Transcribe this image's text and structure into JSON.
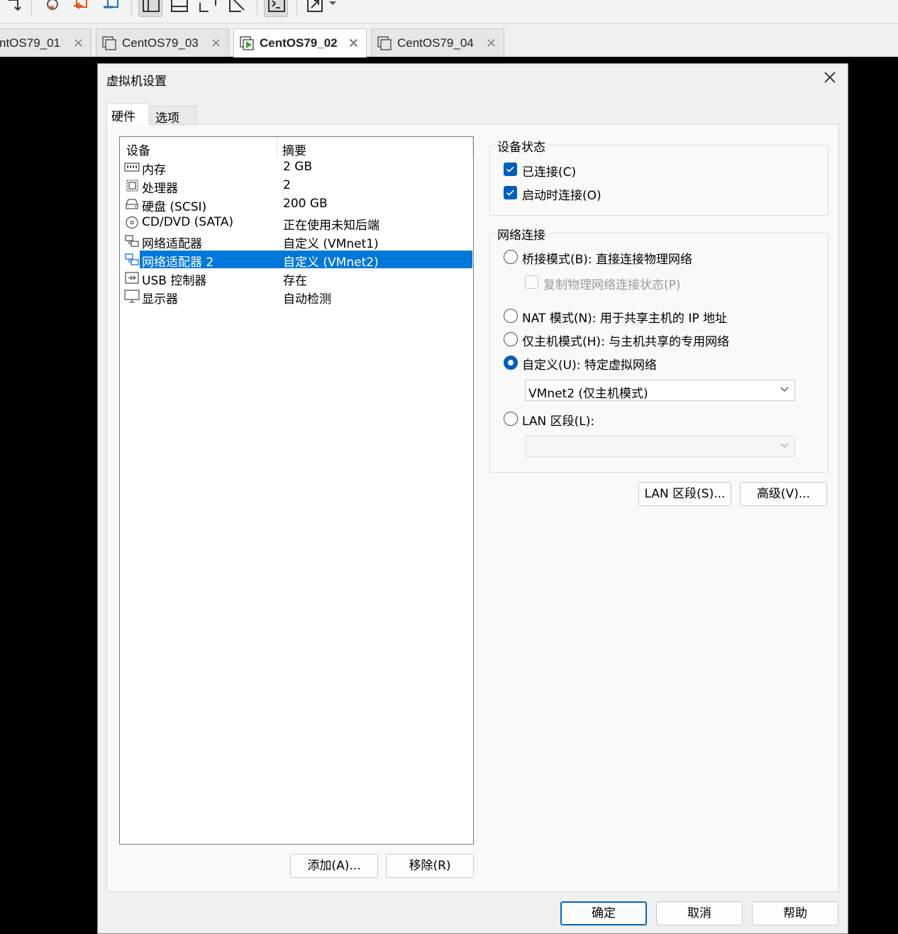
{
  "tabs": [
    {
      "label": "ntOS79_01",
      "active": false
    },
    {
      "label": "CentOS79_03",
      "active": false
    },
    {
      "label": "CentOS79_02",
      "active": true
    },
    {
      "label": "CentOS79_04",
      "active": false
    }
  ],
  "dialog": {
    "title": "虚拟机设置",
    "tab_hardware": "硬件",
    "tab_options": "选项",
    "col_device": "设备",
    "col_summary": "摘要",
    "devices": [
      {
        "icon": "memory-icon",
        "name": "内存",
        "summary": "2 GB"
      },
      {
        "icon": "cpu-icon",
        "name": "处理器",
        "summary": "2"
      },
      {
        "icon": "harddisk-icon",
        "name": "硬盘 (SCSI)",
        "summary": "200 GB"
      },
      {
        "icon": "cdrom-icon",
        "name": "CD/DVD (SATA)",
        "summary": "正在使用未知后端"
      },
      {
        "icon": "network-icon",
        "name": "网络适配器",
        "summary": "自定义 (VMnet1)"
      },
      {
        "icon": "network-icon",
        "name": "网络适配器 2",
        "summary": "自定义 (VMnet2)",
        "selected": true
      },
      {
        "icon": "usb-icon",
        "name": "USB 控制器",
        "summary": "存在"
      },
      {
        "icon": "display-icon",
        "name": "显示器",
        "summary": "自动检测"
      }
    ],
    "add_button": "添加(A)...",
    "remove_button": "移除(R)",
    "device_status": {
      "title": "设备状态",
      "connected": "已连接(C)",
      "connect_at_power_on": "启动时连接(O)"
    },
    "network": {
      "title": "网络连接",
      "bridged": "桥接模式(B): 直接连接物理网络",
      "replicate": "复制物理网络连接状态(P)",
      "nat": "NAT 模式(N): 用于共享主机的 IP 地址",
      "host_only": "仅主机模式(H): 与主机共享的专用网络",
      "custom": "自定义(U): 特定虚拟网络",
      "custom_value": "VMnet2 (仅主机模式)",
      "lan_segment": "LAN 区段(L):",
      "lan_segment_value": ""
    },
    "lan_segments_button": "LAN 区段(S)...",
    "advanced_button": "高级(V)...",
    "ok_button": "确定",
    "cancel_button": "取消",
    "help_button": "帮助"
  }
}
